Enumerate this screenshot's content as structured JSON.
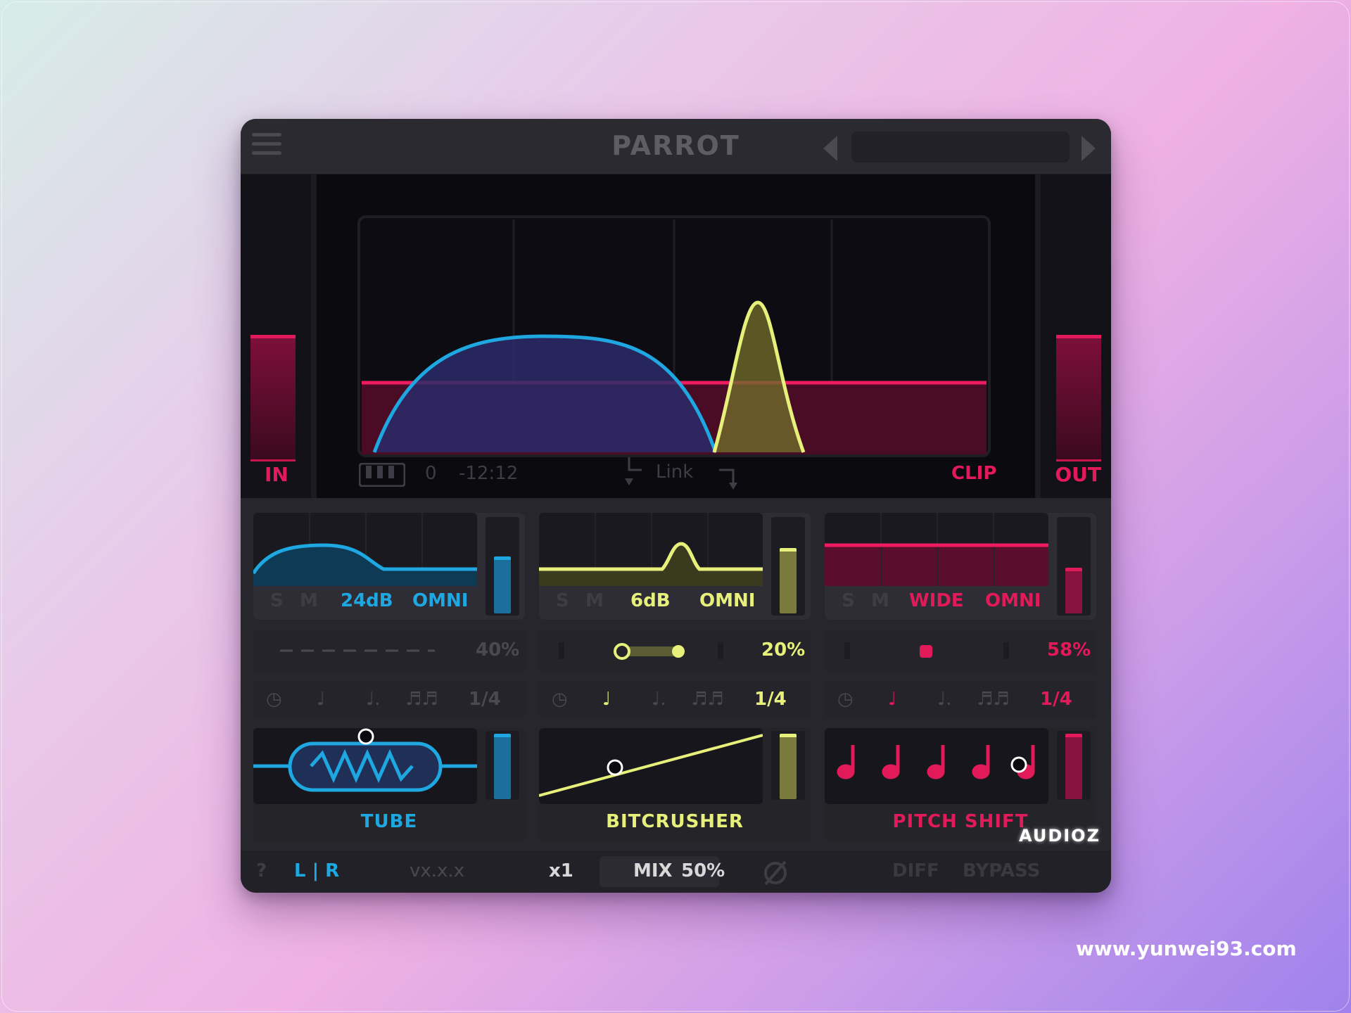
{
  "header": {
    "title": "PARROT"
  },
  "display": {
    "in_label": "IN",
    "out_label": "OUT",
    "clip_label": "CLIP",
    "link_label": "Link",
    "value_a": "0",
    "value_b": "-12:12"
  },
  "modules": [
    {
      "s": "S",
      "m": "M",
      "opt1": "24dB",
      "opt2": "OMNI",
      "percent": "40%",
      "rate": "1/4",
      "fx": "TUBE",
      "color": "#1ea7e0"
    },
    {
      "s": "S",
      "m": "M",
      "opt1": "6dB",
      "opt2": "OMNI",
      "percent": "20%",
      "rate": "1/4",
      "fx": "BITCRUSHER",
      "color": "#e6f07a"
    },
    {
      "s": "S",
      "m": "M",
      "opt1": "WIDE",
      "opt2": "OMNI",
      "percent": "58%",
      "rate": "1/4",
      "fx": "PITCH SHIFT",
      "color": "#e21a5a"
    }
  ],
  "footer": {
    "help": "?",
    "lr": "L | R",
    "version": "vx.x.x",
    "oversample": "x1",
    "mix_label": "MIX",
    "mix_value": "50%",
    "diff": "DIFF",
    "bypass": "BYPASS"
  },
  "watermark": {
    "site": "www.yunwei93.com",
    "logo": "AUDIOZ"
  }
}
